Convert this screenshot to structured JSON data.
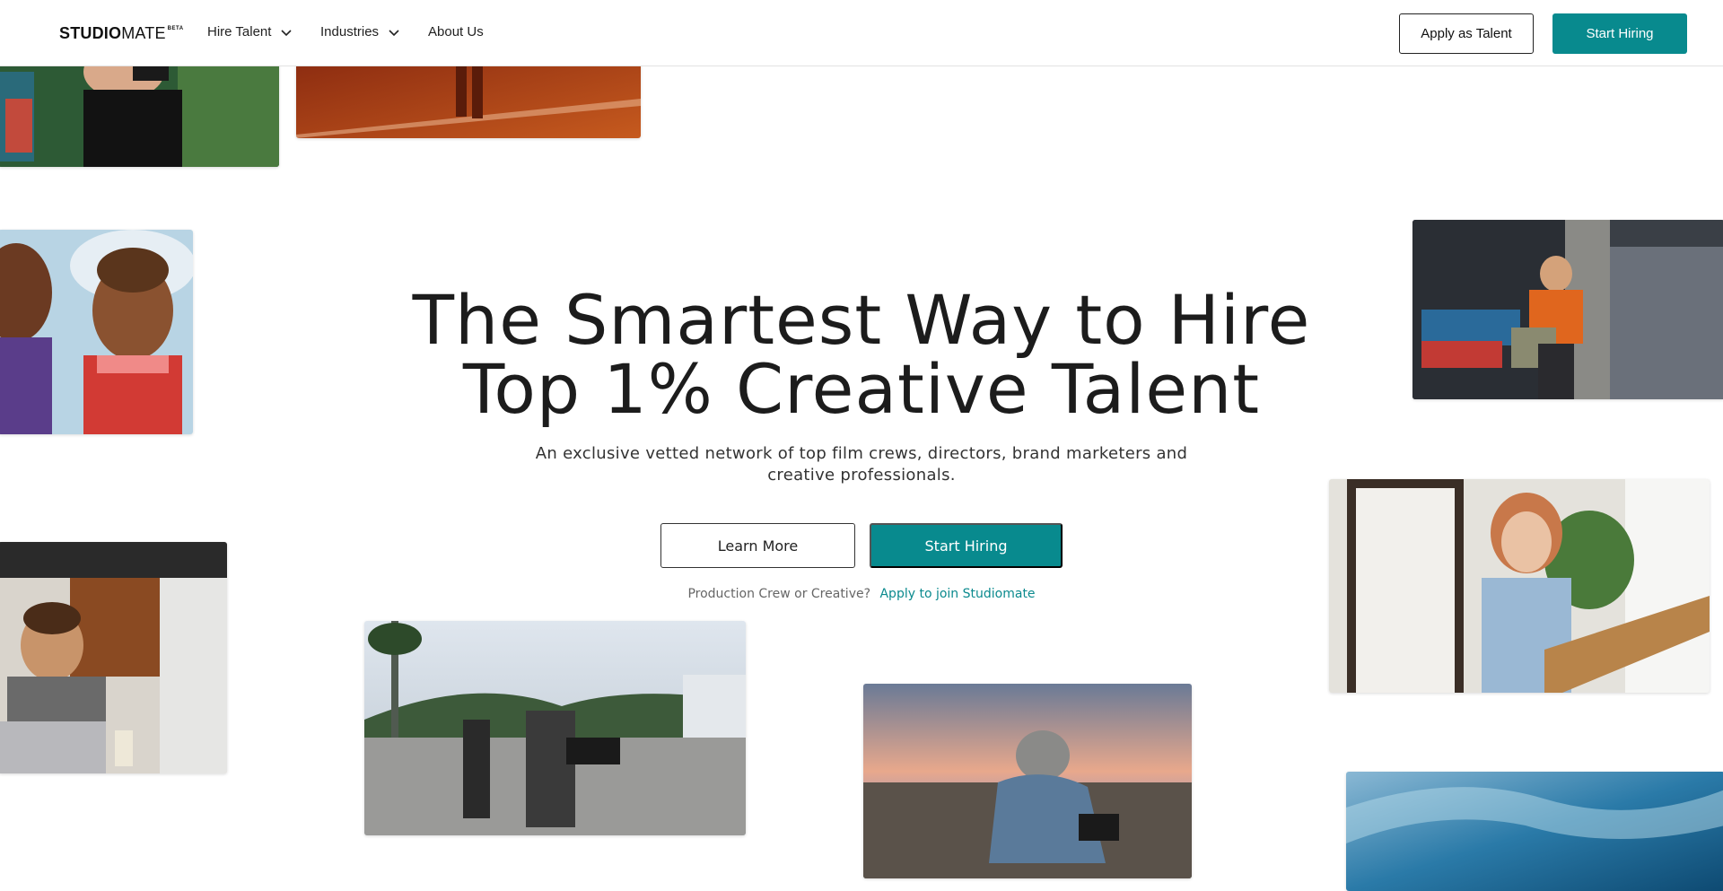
{
  "brand": {
    "logo_bold": "STUDIO",
    "logo_light": "MATE",
    "logo_badge": "BETA"
  },
  "nav": {
    "items": [
      {
        "label": "Hire Talent",
        "icon": "chevron-down-icon"
      },
      {
        "label": "Industries",
        "icon": "chevron-down-icon"
      },
      {
        "label": "About Us"
      }
    ],
    "apply_label": "Apply as Talent",
    "start_label": "Start Hiring"
  },
  "hero": {
    "title_line1": "The Smartest Way to Hire",
    "title_line2": "Top 1% Creative Talent",
    "subtitle_line1": "An exclusive vetted network of top film crews, directors, brand marketers and",
    "subtitle_line2": "creative professionals.",
    "learn_more_label": "Learn More",
    "start_hiring_label": "Start Hiring",
    "apply_prompt": "Production Crew or Creative?",
    "apply_link": "Apply to join Studiomate"
  },
  "colors": {
    "accent": "#088a8e",
    "link": "#0b8a8e",
    "text": "#1c1c1c"
  }
}
